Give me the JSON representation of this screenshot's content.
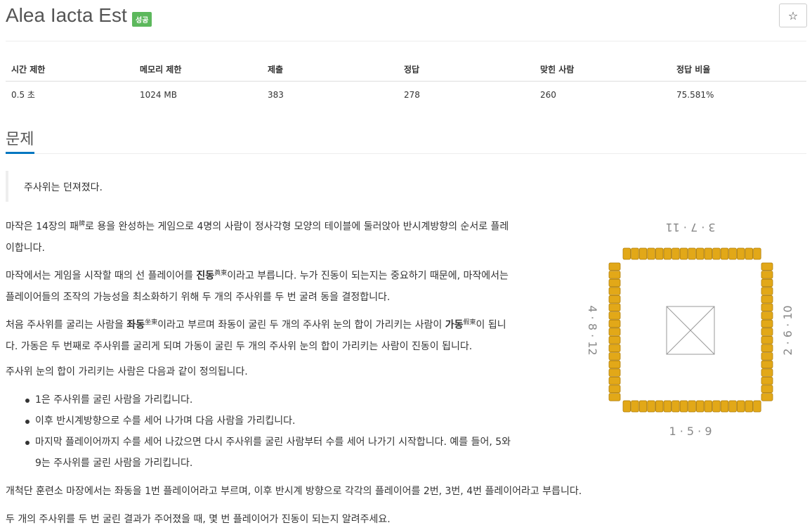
{
  "header": {
    "title": "Alea Iacta Est",
    "badge": "성공",
    "star_icon": "star-icon"
  },
  "info_table": {
    "headers": [
      "시간 제한",
      "메모리 제한",
      "제출",
      "정답",
      "맞힌 사람",
      "정답 비율"
    ],
    "row": [
      "0.5 초",
      "1024 MB",
      "383",
      "278",
      "260",
      "75.581%"
    ]
  },
  "problem": {
    "section_title": "문제",
    "quote": "주사위는 던져졌다.",
    "p1_l1a": "마작은 14장의 패",
    "p1_ruby": "牌",
    "p1_l1b": "로 용을 완성하는 게임으로 4명의 사람이 정사각형 모양의 테이블에 둘러앉아 반시계방향의 순서로 플레",
    "p1_l2": "이합니다.",
    "p2_l1a": "마작에서는 게임을 시작할 때의 선 플레이어를 ",
    "p2_bold": "진동",
    "p2_ruby": "眞東",
    "p2_l1b": "이라고 부릅니다. 누가 진동이 되는지는 중요하기 때문에, 마작에서는",
    "p2_l2": "플레이어들의 조작의 가능성을 최소화하기 위해 두 개의 주사위를 두 번 굴려 동을 결정합니다.",
    "p3_l1a": "처음 주사위를 굴리는 사람을 ",
    "p3_bold1": "좌동",
    "p3_ruby1": "坐東",
    "p3_l1b": "이라고 부르며 좌동이 굴린 두 개의 주사위 눈의 합이 가리키는 사람이 ",
    "p3_bold2": "가동",
    "p3_ruby2": "假東",
    "p3_l1c": "이 됩니",
    "p3_l2": "다. 가동은 두 번째로 주사위를 굴리게 되며 가동이 굴린 두 개의 주사위 눈의 합이 가리키는 사람이 진동이 됩니다.",
    "p4": "주사위 눈의 합이 가리키는 사람은 다음과 같이 정의됩니다.",
    "bullets": [
      "1은 주사위를 굴린 사람을 가리킵니다.",
      "이후 반시계방향으로 수를 세어 나가며 다음 사람을 가리킵니다.",
      "마지막 플레이어까지 수를 세어 나갔으면 다시 주사위를 굴린 사람부터 수를 세어 나가기 시작합니다. 예를 들어, 5와"
    ],
    "bullet3_l2": "9는 주사위를 굴린 사람을 가리킵니다.",
    "p5": "개척단 훈련소 마장에서는 좌동을 1번 플레이어라고 부르며, 이후 반시계 방향으로 각각의 플레이어를 2번, 3번, 4번 플레이어라고 부릅니다.",
    "p6": "두 개의 주사위를 두 번 굴린 결과가 주어졌을 때, 몇 번 플레이어가 진동이 되는지 알려주세요."
  },
  "figure": {
    "top_label": "3 · 7 · 11",
    "left_label": "4 · 8 · 12",
    "right_label": "2 · 6 · 10",
    "bottom_label": "1 · 5 · 9",
    "tile_color": "#e2a818",
    "tile_border": "#b07e0a"
  },
  "colors": {
    "badge": "#5cb85c",
    "section_accent": "#0076c0"
  }
}
